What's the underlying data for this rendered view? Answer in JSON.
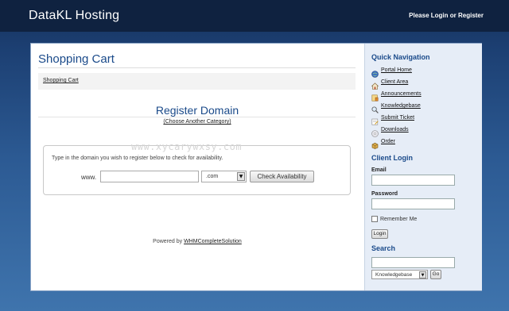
{
  "header": {
    "brand": "DataKL Hosting",
    "login_link": "Please Login",
    "or_text": " or ",
    "register_link": "Register"
  },
  "main": {
    "title": "Shopping Cart",
    "breadcrumb": "Shopping Cart",
    "section_title": "Register Domain",
    "category_link": "(Choose Another Category)",
    "watermark": "www.xycarywxsy.com",
    "instructions": "Type in the domain you wish to register below to check for availability.",
    "www_label": "www.",
    "domain_value": "",
    "tld_selected": ".com",
    "check_button": "Check Availability",
    "powered_prefix": "Powered by ",
    "powered_link": "WHMCompleteSolution"
  },
  "sidebar": {
    "nav_heading": "Quick Navigation",
    "nav_items": [
      {
        "label": "Portal Home",
        "icon": "home-globe-icon"
      },
      {
        "label": "Client Area",
        "icon": "house-icon"
      },
      {
        "label": "Announcements",
        "icon": "announcement-icon"
      },
      {
        "label": "Knowledgebase",
        "icon": "magnifier-icon"
      },
      {
        "label": "Submit Ticket",
        "icon": "ticket-icon"
      },
      {
        "label": "Downloads",
        "icon": "disc-icon"
      },
      {
        "label": "Order",
        "icon": "box-icon"
      }
    ],
    "login_heading": "Client Login",
    "email_label": "Email",
    "password_label": "Password",
    "remember_label": "Remember Me",
    "login_button": "Login",
    "search_heading": "Search",
    "search_select": "Knowledgebase",
    "go_button": "Go"
  },
  "colors": {
    "accent": "#1a4a8a",
    "header_bg": "#0f2240",
    "page_bg": "#2c5a93",
    "sidebar_bg": "#e6edf7"
  }
}
